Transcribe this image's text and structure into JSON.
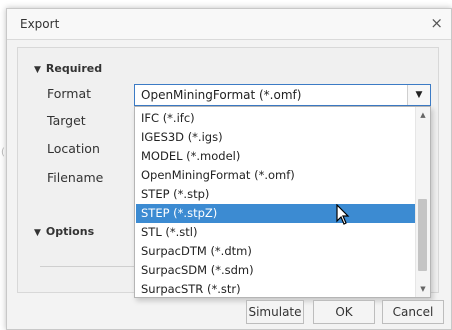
{
  "dialog": {
    "title": "Export",
    "close_glyph": "×"
  },
  "sections": {
    "required": "Required",
    "options": "Options"
  },
  "fields": {
    "format": "Format",
    "target": "Target",
    "location": "Location",
    "filename": "Filename"
  },
  "format_select": {
    "value": "OpenMiningFormat (*.omf)"
  },
  "dropdown": {
    "items": [
      "IFC (*.ifc)",
      "IGES3D (*.igs)",
      "MODEL (*.model)",
      "OpenMiningFormat (*.omf)",
      "STEP (*.stp)",
      "STEP (*.stpZ)",
      "STL (*.stl)",
      "SurpacDTM (*.dtm)",
      "SurpacSDM (*.sdm)",
      "SurpacSTR (*.str)"
    ],
    "selected_index": 5
  },
  "buttons": {
    "simulate": "Simulate",
    "ok": "OK",
    "cancel": "Cancel"
  },
  "icons": {
    "dropdown": "chevron-down-icon",
    "close": "close-icon",
    "scroll_up": "scroll-up-icon",
    "scroll_down": "scroll-down-icon",
    "cursor": "mouse-pointer-icon"
  },
  "colors": {
    "accent": "#3c8bd2"
  }
}
